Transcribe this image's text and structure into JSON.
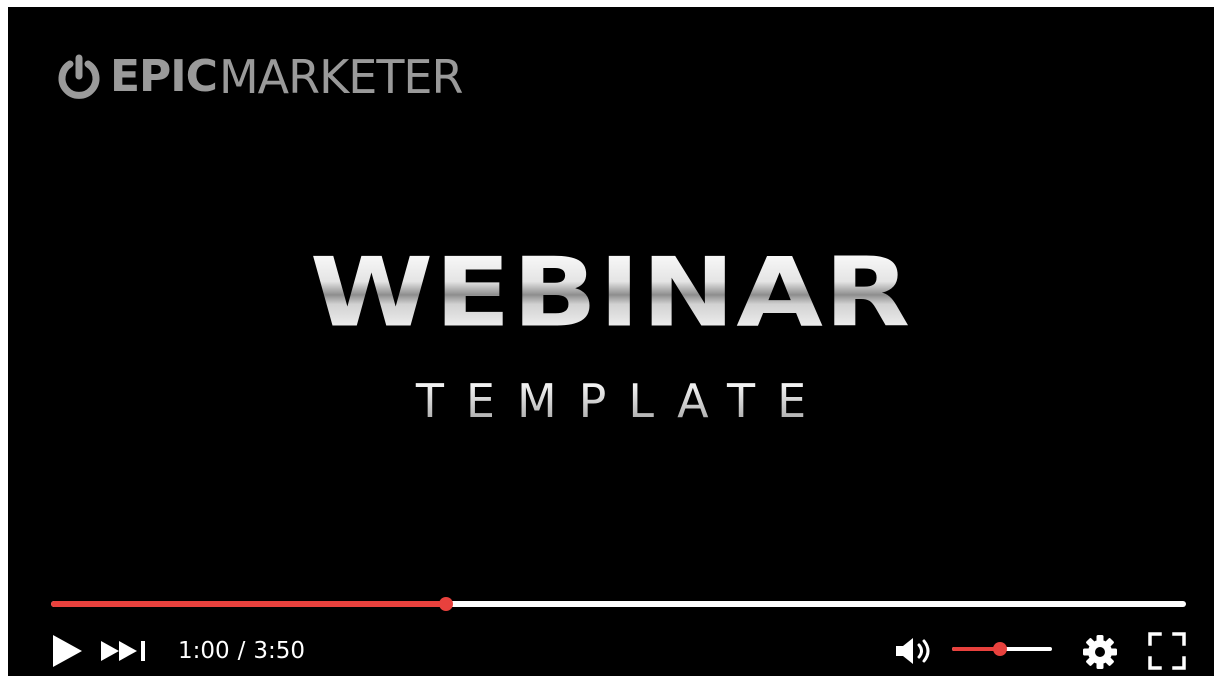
{
  "brand": {
    "bold": "EPIC",
    "light": "MARKETER",
    "icon": "power-icon"
  },
  "title": {
    "main": "WEBINAR",
    "sub": "TEMPLATE"
  },
  "playback": {
    "current_time": "1:00",
    "separator": "/",
    "duration": "3:50",
    "progress_fraction": 0.348
  },
  "volume": {
    "level_fraction": 0.48
  },
  "icons": {
    "play": "play-icon",
    "next": "skip-next-icon",
    "volume": "volume-icon",
    "settings": "gear-icon",
    "fullscreen": "fullscreen-icon"
  },
  "colors": {
    "background": "#000000",
    "accent": "#e8413d",
    "track": "#ffffff",
    "brand_gray": "#9a9a9a",
    "controls": "#ffffff"
  }
}
